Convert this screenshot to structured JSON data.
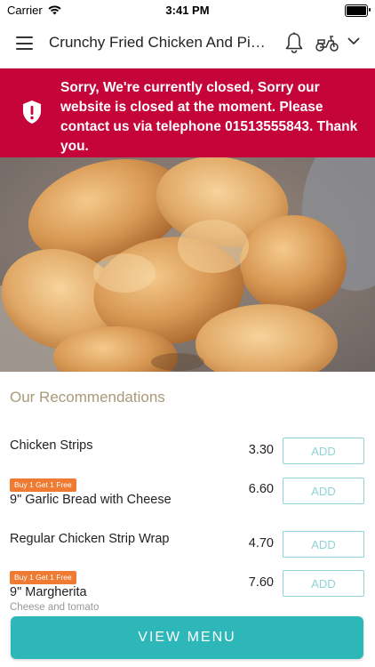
{
  "status_bar": {
    "carrier": "Carrier",
    "time": "3:41 PM"
  },
  "header": {
    "title": "Crunchy Fried Chicken And Pizza",
    "icons": [
      "menu-icon",
      "bell-icon",
      "scooter-icon",
      "chevron-down-icon"
    ]
  },
  "banner": {
    "message": "Sorry, We're currently closed, Sorry our website is closed at the moment. Please contact us via telephone 01513555843. Thank you.",
    "color": "#c5053a"
  },
  "recommendations": {
    "title": "Our Recommendations",
    "items": [
      {
        "name": "Chicken Strips",
        "price": "3.30",
        "add_label": "ADD",
        "badge": "",
        "description": ""
      },
      {
        "name": "9\" Garlic Bread with Cheese",
        "price": "6.60",
        "add_label": "ADD",
        "badge": "Buy 1 Get 1 Free",
        "description": ""
      },
      {
        "name": "Regular Chicken Strip Wrap",
        "price": "4.70",
        "add_label": "ADD",
        "badge": "",
        "description": ""
      },
      {
        "name": "9\" Margherita",
        "price": "7.60",
        "add_label": "ADD",
        "badge": "Buy 1 Get 1 Free",
        "description": "Cheese and tomato"
      }
    ]
  },
  "view_menu_label": "VIEW MENU",
  "colors": {
    "accent": "#2db7b8",
    "banner": "#c5053a",
    "badge": "#ef7a32",
    "section_title": "#a89a79"
  }
}
